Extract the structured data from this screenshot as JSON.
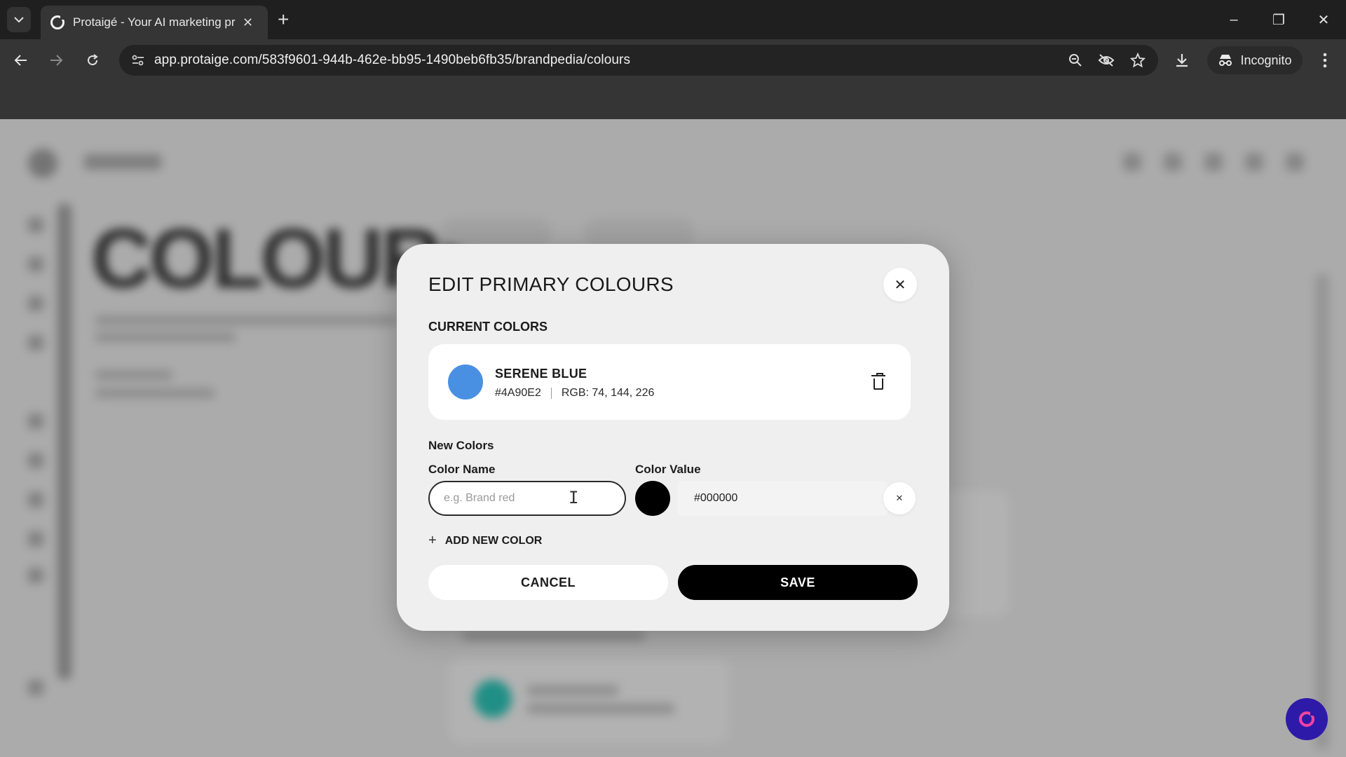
{
  "browser": {
    "tab_title": "Protaigé - Your AI marketing pr",
    "tab_close": "✕",
    "new_tab": "+",
    "url": "app.protaige.com/583f9601-944b-462e-bb95-1490beb6fb35/brandpedia/colours",
    "incognito_label": "Incognito",
    "window_controls": [
      "–",
      "❐",
      "✕"
    ]
  },
  "icons": {
    "tab_search": "chevron-down-icon",
    "back": "arrow-left-icon",
    "forward": "arrow-right-icon",
    "reload": "reload-icon",
    "site_info": "tune-icon",
    "zoom": "zoom-icon",
    "eye_off": "eye-off-icon",
    "bookmark": "star-icon",
    "download": "download-icon",
    "incognito": "incognito-icon",
    "menu": "kebab-icon",
    "chat": "chat-icon"
  },
  "background_page": {
    "heading": "COLOURS"
  },
  "modal": {
    "title": "EDIT PRIMARY COLOURS",
    "close": "✕",
    "current_section_label": "CURRENT COLORS",
    "current_colors": [
      {
        "name": "SERENE BLUE",
        "hex": "#4A90E2",
        "rgb": "RGB: 74, 144, 226",
        "swatch": "#4A90E2"
      }
    ],
    "new_section_label": "New Colors",
    "name_label": "Color Name",
    "name_placeholder": "e.g. Brand red",
    "name_value": "",
    "value_label": "Color Value",
    "value": "#000000",
    "value_swatch": "#000000",
    "row_remove": "✕",
    "add_new_color": "ADD NEW COLOR",
    "add_icon": "+",
    "cancel": "CANCEL",
    "save": "SAVE"
  },
  "colors": {
    "chat_fab": "#2D1AA8",
    "chat_ring": "#FF3FA4",
    "teal_dot": "#22C1B3"
  }
}
